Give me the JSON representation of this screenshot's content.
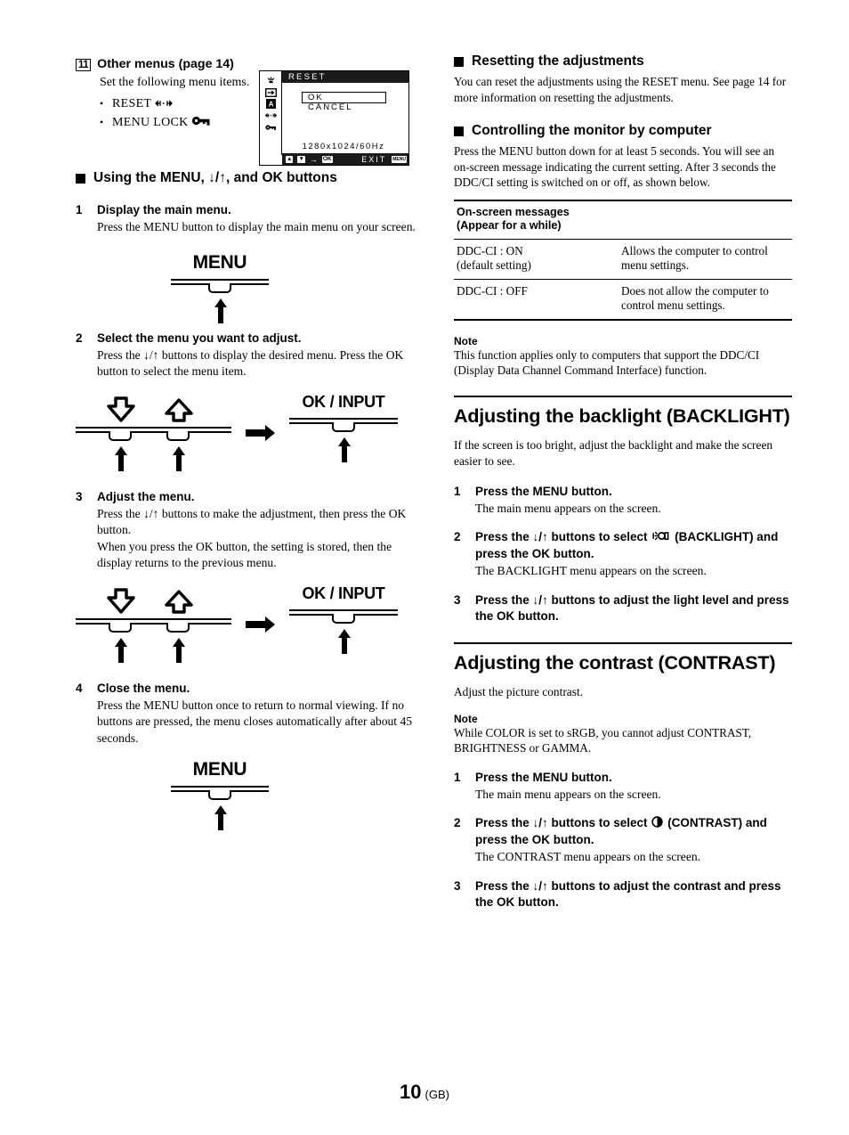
{
  "left": {
    "item11": {
      "number": "11",
      "heading": "Other menus (page 14)",
      "body": "Set the following menu items.",
      "bullets": [
        {
          "label": "RESET",
          "icon": "reset-icon"
        },
        {
          "label": "MENU LOCK",
          "icon": "key-icon"
        }
      ]
    },
    "osd": {
      "title": "RESET",
      "ok": "OK",
      "cancel": "CANCEL",
      "resolution": "1280x1024/60Hz",
      "bar": {
        "arrows": "up-down-badge",
        "select": "OK",
        "exit": "EXIT",
        "menu": "MENU"
      },
      "sidebar_icons": [
        "backlight-icon",
        "input-icon",
        "screen-a-icon",
        "reset-icon",
        "key-icon"
      ]
    },
    "section_heading": "Using the MENU, ↓/↑, and OK buttons",
    "steps": [
      {
        "n": "1",
        "title": "Display the main menu.",
        "body": "Press the MENU button to display the main menu on your screen.",
        "figure": "menu"
      },
      {
        "n": "2",
        "title": "Select the menu you want to adjust.",
        "body": "Press the ↓/↑ buttons to display the desired menu. Press the OK button to select the menu item.",
        "figure": "downup-ok"
      },
      {
        "n": "3",
        "title": "Adjust the menu.",
        "body": "Press the ↓/↑ buttons to make the adjustment, then press the OK button.\nWhen you press the OK button, the setting is stored, then the display returns to the previous menu.",
        "figure": "downup-ok"
      },
      {
        "n": "4",
        "title": "Close the menu.",
        "body": "Press the MENU button once to return to normal viewing. If no buttons are pressed, the menu closes automatically after about 45 seconds.",
        "figure": "menu"
      }
    ],
    "figures": {
      "menu_label": "MENU",
      "ok_label": "OK / INPUT"
    }
  },
  "right": {
    "resetting": {
      "heading": "Resetting the adjustments",
      "body": "You can reset the adjustments using the RESET menu. See page 14 for more information on resetting the adjustments."
    },
    "controlling": {
      "heading": "Controlling the monitor by computer",
      "body": "Press the MENU button down for at least 5 seconds. You will see an on-screen message indicating the current setting. After 3 seconds the DDC/CI setting is switched on or off, as shown below."
    },
    "table": {
      "header": "On-screen messages\n(Appear for a while)",
      "rows": [
        {
          "msg": "DDC-CI : ON\n(default setting)",
          "desc": "Allows the computer to control menu settings."
        },
        {
          "msg": "DDC-CI : OFF",
          "desc": "Does not allow the computer to control menu settings."
        }
      ]
    },
    "note1": {
      "heading": "Note",
      "body": "This function applies only to computers that support the DDC/CI (Display Data Channel Command Interface) function."
    },
    "backlight": {
      "heading": "Adjusting the backlight (BACKLIGHT)",
      "lead": "If the screen is too bright, adjust the backlight and make the screen easier to see.",
      "steps": [
        {
          "n": "1",
          "title": "Press the MENU button.",
          "body": "The main menu appears on the screen."
        },
        {
          "n": "2",
          "title_pre": "Press the ↓/↑ buttons to select",
          "icon": "backlight-icon",
          "title_post": "(BACKLIGHT) and press the OK button.",
          "body": "The BACKLIGHT menu appears on the screen."
        },
        {
          "n": "3",
          "title": "Press the ↓/↑ buttons to adjust the light level and press the OK button.",
          "body": ""
        }
      ]
    },
    "contrast": {
      "heading": "Adjusting the contrast (CONTRAST)",
      "lead": "Adjust the picture contrast.",
      "note_heading": "Note",
      "note_body": "While COLOR is set to sRGB, you cannot adjust CONTRAST, BRIGHTNESS or GAMMA.",
      "steps": [
        {
          "n": "1",
          "title": "Press the MENU button.",
          "body": "The main menu appears on the screen."
        },
        {
          "n": "2",
          "title_pre": "Press the ↓/↑ buttons to select",
          "icon": "contrast-icon",
          "title_post": "(CONTRAST) and press the OK button.",
          "body": "The CONTRAST menu appears on the screen."
        },
        {
          "n": "3",
          "title": "Press the ↓/↑ buttons to adjust the contrast and press the OK button.",
          "body": ""
        }
      ]
    }
  },
  "footer": {
    "page": "10",
    "lang": "(GB)"
  },
  "colors": {
    "ink": "#000000",
    "paper": "#ffffff",
    "osd_bar": "#1b1b1b"
  }
}
